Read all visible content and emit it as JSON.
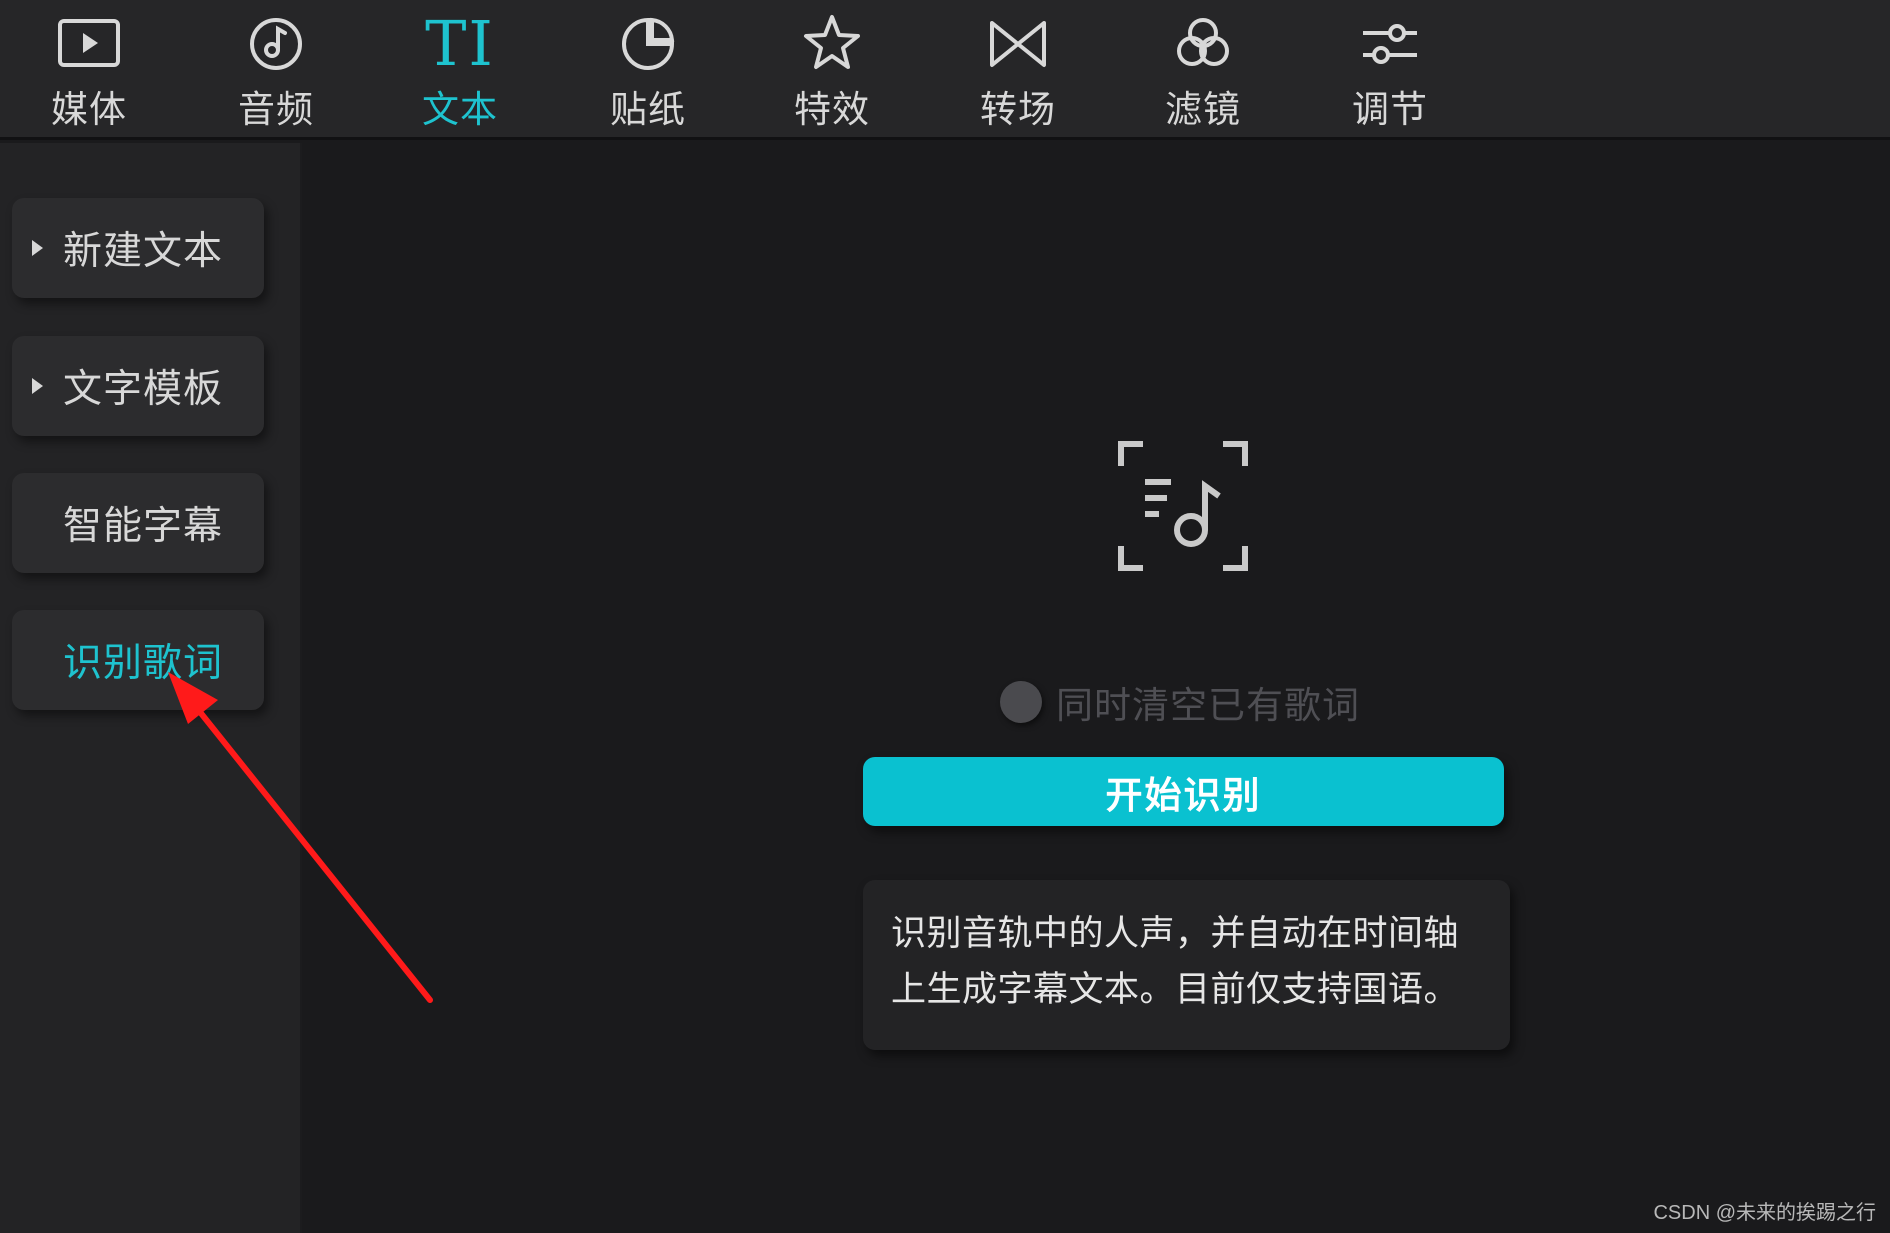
{
  "toolbar": {
    "tabs": [
      {
        "label": "媒体",
        "icon": "media-icon"
      },
      {
        "label": "音频",
        "icon": "audio-icon"
      },
      {
        "label": "文本",
        "icon": "text-icon",
        "glyph": "TI",
        "active": true
      },
      {
        "label": "贴纸",
        "icon": "sticker-icon"
      },
      {
        "label": "特效",
        "icon": "effects-icon"
      },
      {
        "label": "转场",
        "icon": "transition-icon"
      },
      {
        "label": "滤镜",
        "icon": "filter-icon"
      },
      {
        "label": "调节",
        "icon": "adjust-icon"
      }
    ]
  },
  "sidebar": {
    "items": [
      {
        "label": "新建文本",
        "expandable": true
      },
      {
        "label": "文字模板",
        "expandable": true
      },
      {
        "label": "智能字幕",
        "expandable": false
      },
      {
        "label": "识别歌词",
        "expandable": false,
        "active": true
      }
    ]
  },
  "main": {
    "icon": "lyrics-recognition-icon",
    "clear_checkbox_label": "同时清空已有歌词",
    "start_button_label": "开始识别",
    "description": "识别音轨中的人声，并自动在时间轴上生成字幕文本。目前仅支持国语。"
  },
  "watermark": "CSDN @未来的挨踢之行",
  "colors": {
    "accent": "#1ec3cf",
    "button": "#0ac1d0",
    "background": "#1a1a1c",
    "toolbar": "#262628",
    "annotation_arrow": "#ff1a1a"
  }
}
